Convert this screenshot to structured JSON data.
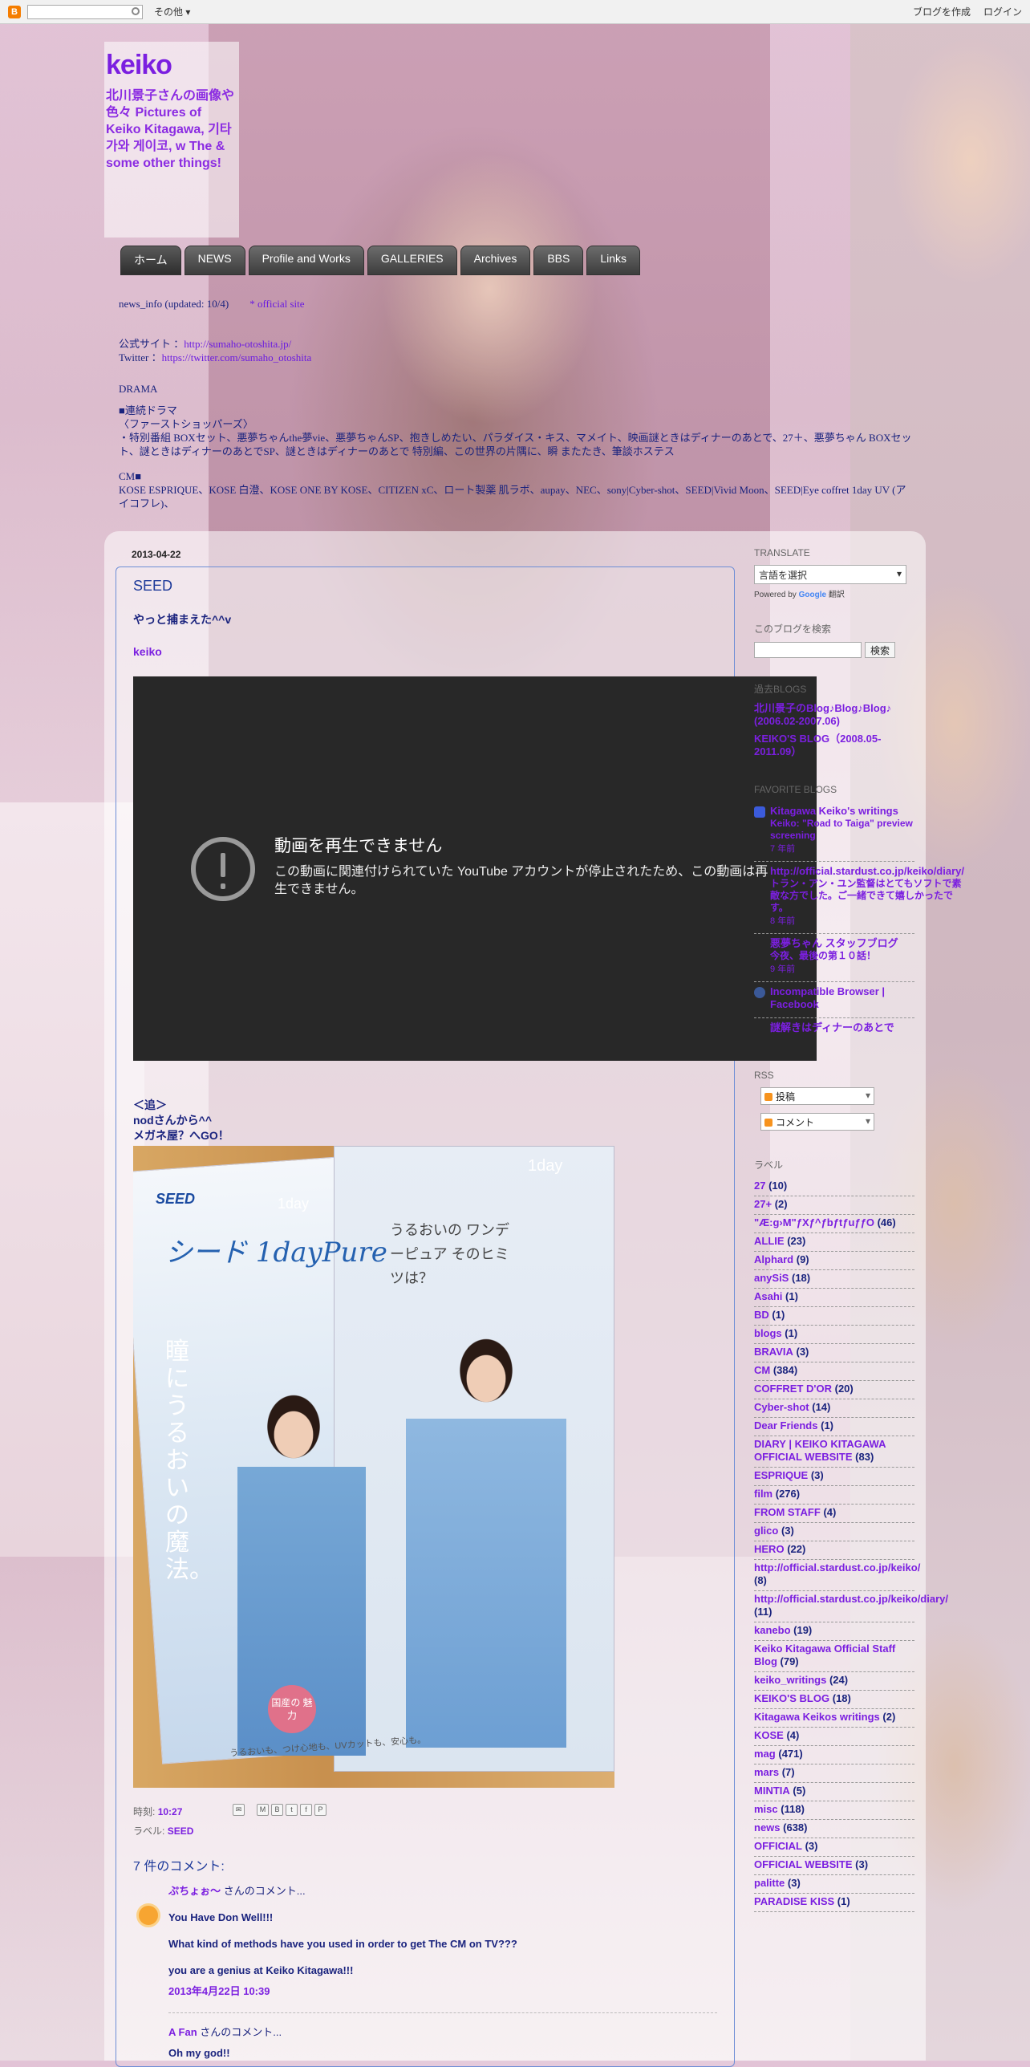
{
  "navbar": {
    "more": "その他 ▾",
    "create_blog": "ブログを作成",
    "login": "ログイン"
  },
  "header": {
    "title": "keiko",
    "description": "北川景子さんの画像や色々 Pictures of Keiko Kitagawa, 기타가와 게이코, w The & some other things!"
  },
  "tabs": [
    "ホーム",
    "NEWS",
    "Profile and Works",
    "GALLERIES",
    "Archives",
    "BBS",
    "Links"
  ],
  "info": {
    "line1_a": "news_info (updated: 10/4)",
    "line1_b": "* official site",
    "line2_label": "公式サイト ：",
    "line2_link": "http://sumaho-otoshita.jp/",
    "line3_label": "Twitter ：",
    "line3_link": "https://twitter.com/sumaho_otoshita",
    "line4": "DRAMA",
    "line5": "■連続ドラマ",
    "line6": "〈ファーストショッパーズ〉",
    "line7": "・特別番組 BOXセット、悪夢ちゃんthe夢vie、悪夢ちゃんSP、抱きしめたい、パラダイス・キス、マメイト、映画謎ときはディナーのあとで、27＋、悪夢ちゃん BOXセット、謎ときはディナーのあとでSP、謎ときはディナーのあとで 特別編、この世界の片隅に、瞬 またたき、筆談ホステス",
    "line8": "CM■",
    "line9": "KOSE ESPRIQUE、KOSE 白澄、KOSE ONE BY KOSE、CITIZEN xC、ロート製薬 肌ラボ、aupay、NEC、sony|Cyber-shot、SEED|Vivid Moon、SEED|Eye coffret 1day UV (アイコフレ)、"
  },
  "post": {
    "date": "2013-04-22",
    "title": "SEED",
    "subtitle": "やっと捕まえた^^v",
    "author": "keiko",
    "video_error_title": "動画を再生できません",
    "video_error_msg": "この動画に関連付けられていた YouTube アカウントが停止されたため、この動画は再生できません。",
    "addendum_1": "＜追＞",
    "addendum_2": "nodさんから^^",
    "addendum_3": "メガネ屋？へGO！",
    "photo": {
      "brand_logo": "SEED",
      "product": "シード 1dayPure",
      "day_tag": "1day",
      "copy": "うるおいの ワンデーピュア そのヒミツは？",
      "tagline": "瞳にうるおいの魔法。",
      "badge": "国産の 魅力",
      "bottom": "うるおいも、つけ心地も、UVカットも、安心も。"
    },
    "time_label": "時刻:",
    "time": "10:27",
    "labels_label": "ラベル:",
    "label": "SEED",
    "comments_title": "7 件のコメント:",
    "comments": [
      {
        "author": "ぷちょぉ～",
        "suffix": " さんのコメント...",
        "lines": [
          "You Have Don Well!!!",
          "What kind of methods have you used in order to get The CM on TV???",
          "you are a genius at Keiko Kitagawa!!!"
        ],
        "timestamp": "2013年4月22日 10:39"
      },
      {
        "author": "A Fan",
        "suffix": " さんのコメント...",
        "lines": [
          "Oh my god!!"
        ]
      }
    ]
  },
  "sidebar": {
    "translate_heading": "TRANSLATE",
    "translate_select": "言語を選択",
    "powered_prefix": "Powered by",
    "powered_google": "Google",
    "powered_suffix": "翻訳",
    "search_heading": "このブログを検索",
    "search_button": "検索",
    "past_heading": "過去BLOGS",
    "past_links": [
      "北川景子のBlog♪Blog♪Blog♪ (2006.02-2007.06)",
      "KEIKO'S BLOG（2008.05-2011.09）"
    ],
    "fav_heading": "FAVORITE BLOGS",
    "fav_items": [
      {
        "icon": "blogger-icon",
        "title": "Kitagawa Keiko's writings",
        "sub": "Keiko: \"Road to Taiga\" preview screening",
        "time": "7 年前"
      },
      {
        "icon": "blank-icon",
        "title": "http://official.stardust.co.jp/keiko/diary/",
        "sub": "トラン・アン・ユン監督はとてもソフトで素敵な方でした。ご一緒できて嬉しかったです。",
        "time": "8 年前"
      },
      {
        "icon": "blank-icon",
        "title": "悪夢ちゃん スタッフブログ",
        "sub": "今夜、最後の第１０話！",
        "time": "9 年前"
      },
      {
        "icon": "facebook-icon",
        "title": "Incompatible Browser | Facebook",
        "sub": "",
        "time": ""
      },
      {
        "icon": "blank-icon",
        "title": "謎解きはディナーのあとで",
        "sub": "",
        "time": ""
      }
    ],
    "rss_heading": "RSS",
    "rss_posts": "投稿",
    "rss_comments": "コメント",
    "labels_heading": "ラベル",
    "labels": [
      {
        "name": "27",
        "count": "(10)"
      },
      {
        "name": "27+",
        "count": "(2)"
      },
      {
        "name": "\"Æ:g›M\"ƒXƒ^ƒbƒtƒuƒƒO",
        "count": "(46)"
      },
      {
        "name": "ALLIE",
        "count": "(23)"
      },
      {
        "name": "Alphard",
        "count": "(9)"
      },
      {
        "name": "anySiS",
        "count": "(18)"
      },
      {
        "name": "Asahi",
        "count": "(1)"
      },
      {
        "name": "BD",
        "count": "(1)"
      },
      {
        "name": "blogs",
        "count": "(1)"
      },
      {
        "name": "BRAVIA",
        "count": "(3)"
      },
      {
        "name": "CM",
        "count": "(384)"
      },
      {
        "name": "COFFRET D'OR",
        "count": "(20)"
      },
      {
        "name": "Cyber-shot",
        "count": "(14)"
      },
      {
        "name": "Dear Friends",
        "count": "(1)"
      },
      {
        "name": "DIARY | KEIKO KITAGAWA OFFICIAL WEBSITE",
        "count": "(83)"
      },
      {
        "name": "ESPRIQUE",
        "count": "(3)"
      },
      {
        "name": "film",
        "count": "(276)"
      },
      {
        "name": "FROM STAFF",
        "count": "(4)"
      },
      {
        "name": "glico",
        "count": "(3)"
      },
      {
        "name": "HERO",
        "count": "(22)"
      },
      {
        "name": "http://official.stardust.co.jp/keiko/",
        "count": "(8)"
      },
      {
        "name": "http://official.stardust.co.jp/keiko/diary/",
        "count": "(11)"
      },
      {
        "name": "kanebo",
        "count": "(19)"
      },
      {
        "name": "Keiko Kitagawa Official Staff Blog",
        "count": "(79)"
      },
      {
        "name": "keiko_writings",
        "count": "(24)"
      },
      {
        "name": "KEIKO'S BLOG",
        "count": "(18)"
      },
      {
        "name": "Kitagawa Keikos writings",
        "count": "(2)"
      },
      {
        "name": "KOSE",
        "count": "(4)"
      },
      {
        "name": "mag",
        "count": "(471)"
      },
      {
        "name": "mars",
        "count": "(7)"
      },
      {
        "name": "MINTIA",
        "count": "(5)"
      },
      {
        "name": "misc",
        "count": "(118)"
      },
      {
        "name": "news",
        "count": "(638)"
      },
      {
        "name": "OFFICIAL",
        "count": "(3)"
      },
      {
        "name": "OFFICIAL WEBSITE",
        "count": "(3)"
      },
      {
        "name": "palitte",
        "count": "(3)"
      },
      {
        "name": "PARADISE KISS",
        "count": "(1)"
      }
    ]
  }
}
